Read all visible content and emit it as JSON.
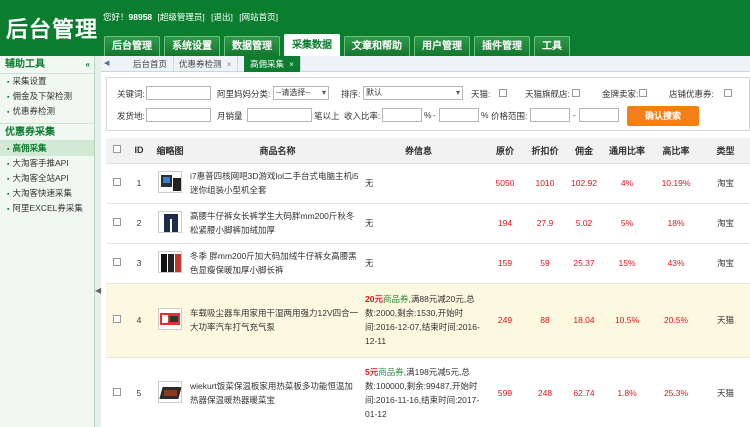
{
  "header": {
    "logo": "后台管理",
    "greeting": "您好！",
    "user_id": "98958",
    "role": "[超级管理员]",
    "logout": "[退出]",
    "site_home": "[网站首页]",
    "nav": [
      "后台管理",
      "系统设置",
      "数据管理",
      "采集数据",
      "文章和帮助",
      "用户管理",
      "插件管理",
      "工具"
    ],
    "active_nav": "采集数据"
  },
  "sidebar": {
    "section1": "辅助工具",
    "section1_items": [
      "采集设置",
      "佣金及下架检测",
      "优惠券检测"
    ],
    "section2": "优惠券采集",
    "section2_items": [
      "高佣采集",
      "大淘客手推API",
      "大淘客全站API",
      "大淘客快速采集",
      "阿里EXCEL券采集"
    ],
    "active_item": "高佣采集"
  },
  "page_tabs": [
    {
      "label": "后台首页",
      "closable": false
    },
    {
      "label": "优惠券检测",
      "closable": true
    },
    {
      "label": "高佣采集",
      "closable": true
    }
  ],
  "filter": {
    "keyword_label": "关键词:",
    "category_label": "阿里妈妈分类:",
    "category_value": "--请选择--",
    "sort_label": "排序:",
    "sort_value": "默认",
    "tmall_label": "天猫:",
    "tmall_flagship_label": "天猫旗舰店:",
    "gold_seller_label": "金牌卖家:",
    "shop_coupon_label": "店铺优惠券:",
    "ship_from_label": "发货地:",
    "monthly_sales_label": "月销量",
    "above_label": "笔以上",
    "commission_label": "收入比率:",
    "percent": "%",
    "dash": "-",
    "price_label": "价格范围:",
    "search_button": "确认搜索"
  },
  "table": {
    "columns": [
      "",
      "ID",
      "缩略图",
      "商品名称",
      "券信息",
      "原价",
      "折扣价",
      "佣金",
      "通用比率",
      "高比率",
      "类型"
    ],
    "rows": [
      {
        "id": "1",
        "name": "i7惠普四核网吧3D游戏lol二手台式电脑主机i5迷你组装小型机全套",
        "coupon_amt": "",
        "coupon_type": "",
        "coupon_rest": "无",
        "price": "5050",
        "discount": "1010",
        "commission": "102.92",
        "general_rate": "4%",
        "high_rate": "10.19%",
        "type": "淘宝",
        "highlight": false
      },
      {
        "id": "2",
        "name": "高腰牛仔裤女长裤学生大码胖mm200斤秋冬松紧腰小脚裤加绒加厚",
        "coupon_amt": "",
        "coupon_type": "",
        "coupon_rest": "无",
        "price": "194",
        "discount": "27.9",
        "commission": "5.02",
        "general_rate": "5%",
        "high_rate": "18%",
        "type": "淘宝",
        "highlight": false
      },
      {
        "id": "3",
        "name": "冬季 胖mm200斤加大码加绒牛仔裤女高腰黑色显瘦保暖加厚小脚长裤",
        "coupon_amt": "",
        "coupon_type": "",
        "coupon_rest": "无",
        "price": "159",
        "discount": "59",
        "commission": "25.37",
        "general_rate": "15%",
        "high_rate": "43%",
        "type": "淘宝",
        "highlight": false
      },
      {
        "id": "4",
        "name": "车载吸尘器车用家用干湿两用强力12V四合一大功率汽车打气充气泵",
        "coupon_amt": "20元",
        "coupon_type": "商品券",
        "coupon_rest": ",满88元减20元,总数:2000,剩余:1530,开始时间:2016-12-07,结束时间:2016-12-11",
        "price": "249",
        "discount": "88",
        "commission": "18.04",
        "general_rate": "10.5%",
        "high_rate": "20.5%",
        "type": "天猫",
        "highlight": true
      },
      {
        "id": "5",
        "name": "wiekurt饭菜保温板家用热菜板多功能恒温加热器保温暖热器暖菜宝",
        "coupon_amt": "5元",
        "coupon_type": "商品券",
        "coupon_rest": ",满198元减5元,总数:100000,剩余:99487,开始时间:2016-11-16,结束时间:2017-01-12",
        "price": "599",
        "discount": "248",
        "commission": "62.74",
        "general_rate": "1.8%",
        "high_rate": "25.3%",
        "type": "天猫",
        "highlight": false
      }
    ]
  }
}
